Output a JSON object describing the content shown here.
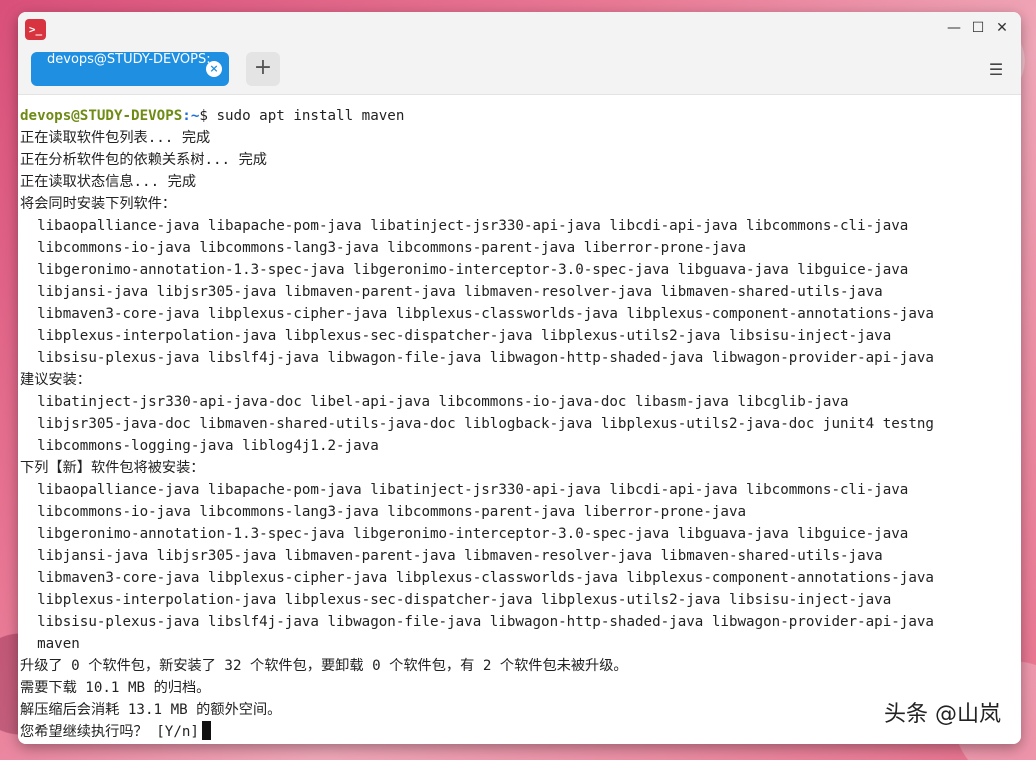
{
  "window": {
    "app_icon_glyph": ">_",
    "minimize_glyph": "—",
    "maximize_glyph": "☐",
    "close_glyph": "✕"
  },
  "tabs": [
    {
      "label": "devops@STUDY-DEVOPS:",
      "close_glyph": "×"
    }
  ],
  "add_tab_glyph": "+",
  "menu_glyph": "☰",
  "prompt": {
    "user_host": "devops@STUDY-DEVOPS",
    "path": ":~",
    "symbol": "$",
    "command": " sudo apt install maven"
  },
  "output_lines": [
    "正在读取软件包列表... 完成",
    "正在分析软件包的依赖关系树... 完成",
    "正在读取状态信息... 完成",
    "将会同时安装下列软件：",
    "  libaopalliance-java libapache-pom-java libatinject-jsr330-api-java libcdi-api-java libcommons-cli-java",
    "  libcommons-io-java libcommons-lang3-java libcommons-parent-java liberror-prone-java",
    "  libgeronimo-annotation-1.3-spec-java libgeronimo-interceptor-3.0-spec-java libguava-java libguice-java",
    "  libjansi-java libjsr305-java libmaven-parent-java libmaven-resolver-java libmaven-shared-utils-java",
    "  libmaven3-core-java libplexus-cipher-java libplexus-classworlds-java libplexus-component-annotations-java",
    "  libplexus-interpolation-java libplexus-sec-dispatcher-java libplexus-utils2-java libsisu-inject-java",
    "  libsisu-plexus-java libslf4j-java libwagon-file-java libwagon-http-shaded-java libwagon-provider-api-java",
    "建议安装：",
    "  libatinject-jsr330-api-java-doc libel-api-java libcommons-io-java-doc libasm-java libcglib-java",
    "  libjsr305-java-doc libmaven-shared-utils-java-doc liblogback-java libplexus-utils2-java-doc junit4 testng",
    "  libcommons-logging-java liblog4j1.2-java",
    "下列【新】软件包将被安装：",
    "  libaopalliance-java libapache-pom-java libatinject-jsr330-api-java libcdi-api-java libcommons-cli-java",
    "  libcommons-io-java libcommons-lang3-java libcommons-parent-java liberror-prone-java",
    "  libgeronimo-annotation-1.3-spec-java libgeronimo-interceptor-3.0-spec-java libguava-java libguice-java",
    "  libjansi-java libjsr305-java libmaven-parent-java libmaven-resolver-java libmaven-shared-utils-java",
    "  libmaven3-core-java libplexus-cipher-java libplexus-classworlds-java libplexus-component-annotations-java",
    "  libplexus-interpolation-java libplexus-sec-dispatcher-java libplexus-utils2-java libsisu-inject-java",
    "  libsisu-plexus-java libslf4j-java libwagon-file-java libwagon-http-shaded-java libwagon-provider-api-java",
    "  maven",
    "升级了 0 个软件包，新安装了 32 个软件包，要卸载 0 个软件包，有 2 个软件包未被升级。",
    "需要下载 10.1 MB 的归档。",
    "解压缩后会消耗 13.1 MB 的额外空间。"
  ],
  "confirm_prompt": "您希望继续执行吗？ [Y/n]",
  "watermark": "头条 @山岚"
}
